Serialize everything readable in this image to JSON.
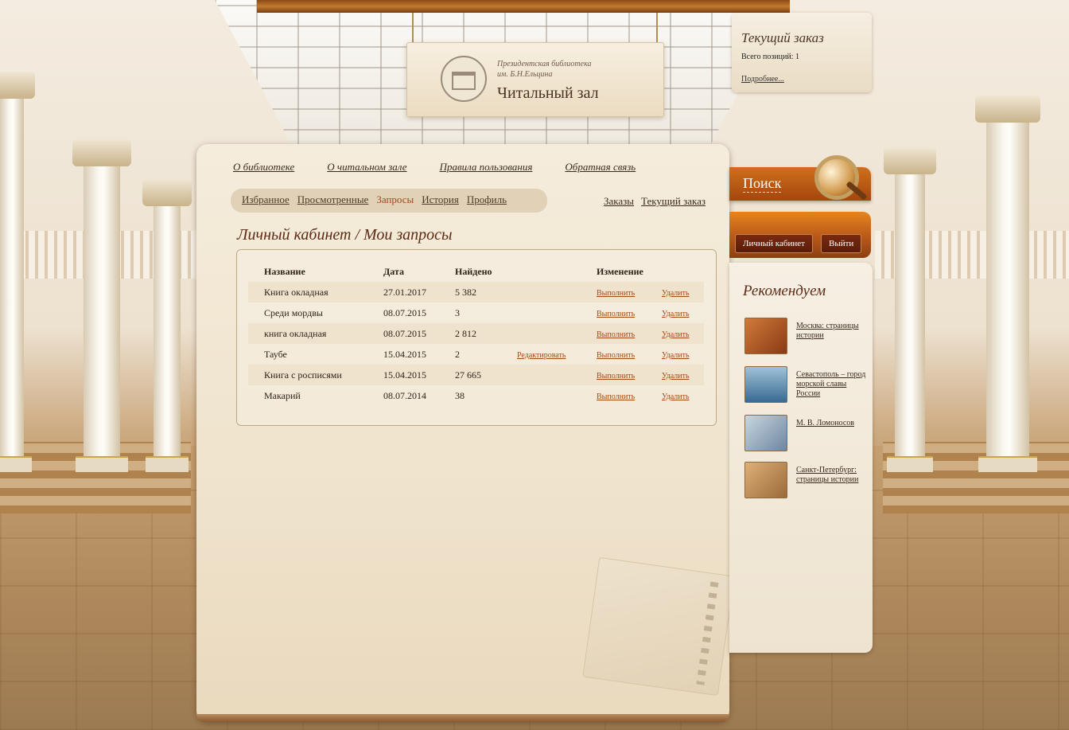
{
  "sign": {
    "subtitle_line1": "Президентская библиотека",
    "subtitle_line2": "им. Б.Н.Ельцина",
    "title": "Читальный зал"
  },
  "order_box": {
    "title": "Текущий заказ",
    "count": "Всего позиций: 1",
    "more_link": "Подробнее..."
  },
  "topnav": [
    "О библиотеке",
    "О читальном зале",
    "Правила пользования",
    "Обратная связь"
  ],
  "tabs": [
    {
      "label": "Избранное",
      "active": false
    },
    {
      "label": "Просмотренные",
      "active": false
    },
    {
      "label": "Запросы",
      "active": true
    },
    {
      "label": "История",
      "active": false
    },
    {
      "label": "Профиль",
      "active": false
    }
  ],
  "right_links": [
    "Заказы",
    "Текущий заказ"
  ],
  "page_title": "Личный кабинет / Мои запросы",
  "table": {
    "headers": [
      "Название",
      "Дата",
      "Найдено",
      "",
      "Изменение",
      ""
    ],
    "rows": [
      {
        "name": "Книга окладная",
        "date": "27.01.2017",
        "found": "5 382",
        "edit": "",
        "run": "Выполнить",
        "delete": "Удалить"
      },
      {
        "name": "Среди мордвы",
        "date": "08.07.2015",
        "found": "3",
        "edit": "",
        "run": "Выполнить",
        "delete": "Удалить"
      },
      {
        "name": "книга окладная",
        "date": "08.07.2015",
        "found": "2 812",
        "edit": "",
        "run": "Выполнить",
        "delete": "Удалить"
      },
      {
        "name": "Таубе",
        "date": "15.04.2015",
        "found": "2",
        "edit": "Редактировать",
        "run": "Выполнить",
        "delete": "Удалить"
      },
      {
        "name": "Книга с росписями",
        "date": "15.04.2015",
        "found": "27 665",
        "edit": "",
        "run": "Выполнить",
        "delete": "Удалить"
      },
      {
        "name": "Макарий",
        "date": "08.07.2014",
        "found": "38",
        "edit": "",
        "run": "Выполнить",
        "delete": "Удалить"
      }
    ]
  },
  "search": {
    "label": "Поиск"
  },
  "account": {
    "cabinet_button": "Личный кабинет",
    "logout_button": "Выйти"
  },
  "recommend": {
    "title": "Рекомендуем",
    "items": [
      {
        "label": "Москва: страницы истории",
        "thumb_color": "#b8582a"
      },
      {
        "label": "Севастополь – город морской славы России",
        "thumb_color": "#4f7fa8"
      },
      {
        "label": "М. В. Ломоносов",
        "thumb_color": "#8aa4b8"
      },
      {
        "label": "Санкт-Петербург: страницы истории",
        "thumb_color": "#c08a4a"
      }
    ]
  },
  "colors": {
    "accent": "#a34a16",
    "title": "#5c2a14",
    "search_bar": "#cf6f1c"
  }
}
